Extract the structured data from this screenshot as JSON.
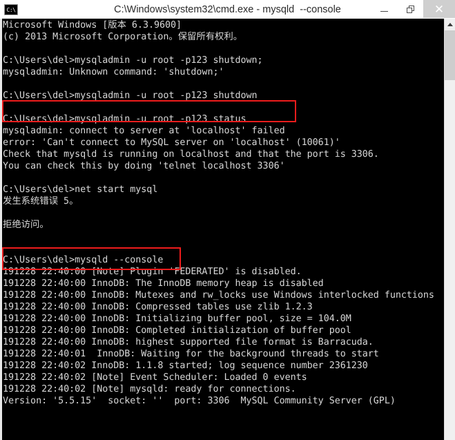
{
  "window": {
    "title": "C:\\Windows\\system32\\cmd.exe - mysqld  --console",
    "icon": "cmd-icon",
    "icon_label": "C:\\",
    "controls": {
      "minimize": "–",
      "maximize": "❐",
      "close": "✕"
    }
  },
  "terminal": {
    "prompt": "C:\\Users\\del>",
    "lines": [
      "Microsoft Windows [版本 6.3.9600]",
      "(c) 2013 Microsoft Corporation。保留所有权利。",
      "",
      "C:\\Users\\del>mysqladmin -u root -p123 shutdown;",
      "mysqladmin: Unknown command: 'shutdown;'",
      "",
      "C:\\Users\\del>mysqladmin -u root -p123 shutdown",
      "",
      "C:\\Users\\del>mysqladmin -u root -p123 status",
      "mysqladmin: connect to server at 'localhost' failed",
      "error: 'Can't connect to MySQL server on 'localhost' (10061)'",
      "Check that mysqld is running on localhost and that the port is 3306.",
      "You can check this by doing 'telnet localhost 3306'",
      "",
      "C:\\Users\\del>net start mysql",
      "发生系统错误 5。",
      "",
      "拒绝访问。",
      "",
      "",
      "C:\\Users\\del>mysqld --console",
      "191228 22:40:00 [Note] Plugin 'FEDERATED' is disabled.",
      "191228 22:40:00 InnoDB: The InnoDB memory heap is disabled",
      "191228 22:40:00 InnoDB: Mutexes and rw_locks use Windows interlocked functions",
      "191228 22:40:00 InnoDB: Compressed tables use zlib 1.2.3",
      "191228 22:40:00 InnoDB: Initializing buffer pool, size = 104.0M",
      "191228 22:40:00 InnoDB: Completed initialization of buffer pool",
      "191228 22:40:00 InnoDB: highest supported file format is Barracuda.",
      "191228 22:40:01  InnoDB: Waiting for the background threads to start",
      "191228 22:40:02 InnoDB: 1.1.8 started; log sequence number 2361230",
      "191228 22:40:02 [Note] Event Scheduler: Loaded 0 events",
      "191228 22:40:02 [Note] mysqld: ready for connections.",
      "Version: '5.5.15'  socket: ''  port: 3306  MySQL Community Server (GPL)"
    ],
    "text_color": "#d8d8d8",
    "background_color": "#000000"
  },
  "annotations": {
    "color": "#ee1c1c",
    "boxes": [
      {
        "label": "mysqladmin-shutdown-highlight",
        "target_text": "C:\\Users\\del>mysqladmin -u root -p123 shutdown"
      },
      {
        "label": "mysqld-console-highlight",
        "target_text": "C:\\Users\\del>mysqld --console"
      }
    ]
  },
  "scrollbar": {
    "up_arrow": "▲",
    "orientation": "vertical"
  }
}
